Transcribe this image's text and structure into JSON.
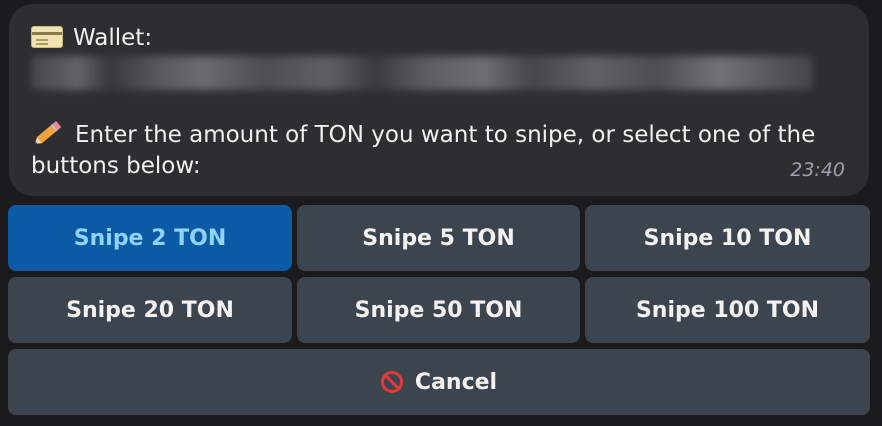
{
  "message": {
    "wallet_label": "Wallet:",
    "wallet_icon": "credit-card-icon",
    "prompt_line1": "Enter the amount of TON you want to snipe, or select one of the",
    "prompt_line2": "buttons below:",
    "prompt_icon": "pencil-icon",
    "timestamp": "23:40"
  },
  "buttons": {
    "snipe_2": "Snipe 2 TON",
    "snipe_5": "Snipe 5 TON",
    "snipe_10": "Snipe 10 TON",
    "snipe_20": "Snipe 20 TON",
    "snipe_50": "Snipe 50 TON",
    "snipe_100": "Snipe 100 TON",
    "cancel": "Cancel",
    "cancel_icon": "no-entry-icon"
  },
  "colors": {
    "active_button_bg": "#0a5aa6",
    "button_bg": "#3c444d",
    "bubble_bg": "#2e2e30"
  }
}
